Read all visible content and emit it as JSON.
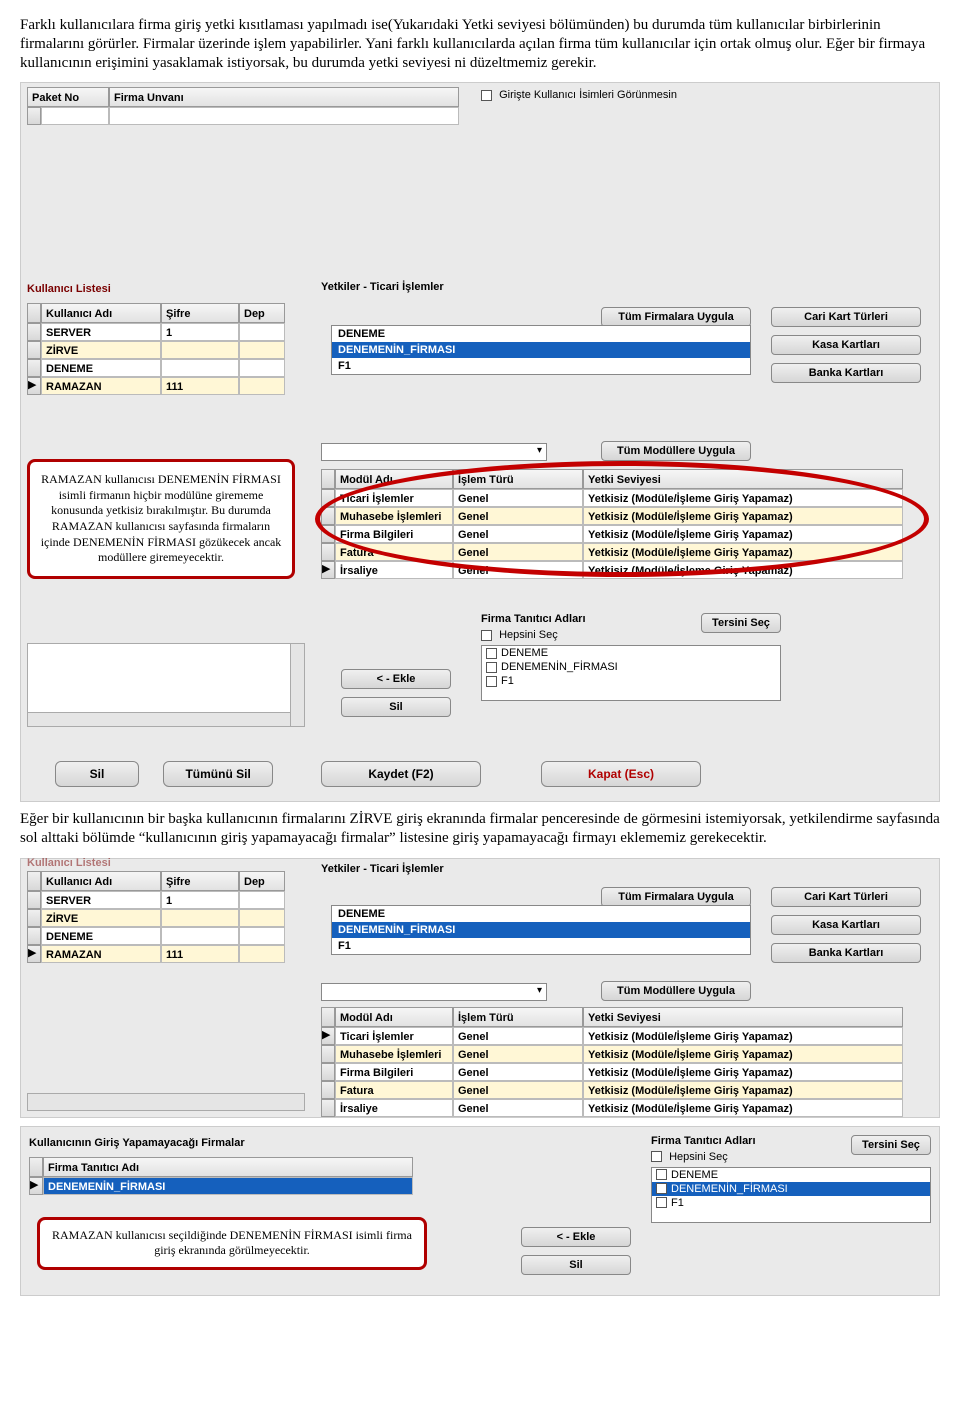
{
  "para1": "Farklı kullanıcılara firma giriş yetki kısıtlaması yapılmadı ise(Yukarıdaki Yetki seviyesi bölümünden) bu durumda tüm kullanıcılar birbirlerinin firmalarını görürler. Firmalar üzerinde işlem yapabilirler. Yani farklı kullanıcılarda açılan firma tüm kullanıcılar için ortak olmuş olur. Eğer bir firmaya kullanıcının erişimini yasaklamak istiyorsak, bu durumda yetki seviyesi ni düzeltmemiz gerekir.",
  "para2": "Eğer bir kullanıcının bir başka kullanıcının firmalarını ZİRVE giriş ekranında firmalar penceresinde de görmesini istemiyorsak, yetkilendirme sayfasında sol alttaki bölümde “kullanıcının giriş yapamayacağı firmalar” listesine giriş yapamayacağı firmayı eklememiz gerekecektir.",
  "callout1": "RAMAZAN kullanıcısı DENEMENİN FİRMASI isimli firmanın hiçbir modülüne girememe konusunda yetkisiz bırakılmıştır. Bu durumda RAMAZAN kullanıcısı sayfasında firmaların içinde DENEMENİN FİRMASI gözükecek ancak modüllere giremeyecektir.",
  "callout2": "RAMAZAN kullanıcısı seçildiğinde DENEMENİN FİRMASI isimli firma giriş ekranında görülmeyecektir.",
  "top": {
    "paketNo": "Paket No",
    "firmaUnvani": "Firma Unvanı",
    "giristeChk": "Girişte Kullanıcı İsimleri Görünmesin"
  },
  "userList": {
    "title": "Kullanıcı Listesi",
    "cols": {
      "ad": "Kullanıcı Adı",
      "sifre": "Şifre",
      "dep": "Dep"
    },
    "rows": [
      {
        "ad": "SERVER",
        "sifre": "1"
      },
      {
        "ad": "ZİRVE",
        "sifre": ""
      },
      {
        "ad": "DENEME",
        "sifre": ""
      },
      {
        "ad": "RAMAZAN",
        "sifre": "111"
      }
    ]
  },
  "yetkiler": {
    "title": "Yetkiler - Ticari İşlemler",
    "tumFirmalara": "Tüm Firmalara Uygula",
    "cariKart": "Cari Kart Türleri",
    "kasa": "Kasa Kartları",
    "banka": "Banka Kartları",
    "firmaListesi": [
      "DENEME",
      "DENEMENİN_FİRMASI",
      "F1"
    ],
    "tumModullere": "Tüm Modüllere Uygula",
    "modulCols": {
      "ad": "Modül Adı",
      "tur": "İşlem Türü",
      "sev": "Yetki Seviyesi"
    },
    "modulRows": [
      {
        "ad": "Ticari İşlemler",
        "tur": "Genel",
        "sev": "Yetkisiz (Modüle/İşleme Giriş Yapamaz)"
      },
      {
        "ad": "Muhasebe İşlemleri",
        "tur": "Genel",
        "sev": "Yetkisiz (Modüle/İşleme Giriş Yapamaz)"
      },
      {
        "ad": "Firma Bilgileri",
        "tur": "Genel",
        "sev": "Yetkisiz (Modüle/İşleme Giriş Yapamaz)"
      },
      {
        "ad": "Fatura",
        "tur": "Genel",
        "sev": "Yetkisiz (Modüle/İşleme Giriş Yapamaz)"
      },
      {
        "ad": "İrsaliye",
        "tur": "Genel",
        "sev": "Yetkisiz (Modüle/İşleme Giriş Yapamaz)"
      }
    ]
  },
  "firmaTanitici": {
    "title": "Firma Tanıtıcı Adları",
    "hepsiniSec": "Hepsini Seç",
    "tersiniSec": "Tersini Seç",
    "items": [
      "DENEME",
      "DENEMENİN_FİRMASI",
      "F1"
    ]
  },
  "girisYapamaz": {
    "title": "Kullanıcının Giriş Yapamayacağı Firmalar",
    "col": "Firma Tanıtıcı Adı",
    "row": "DENEMENİN_FİRMASI"
  },
  "buttons": {
    "ekle": "< - Ekle",
    "sil": "Sil",
    "tumunuSil": "Tümünü Sil",
    "kaydet": "Kaydet (F2)",
    "kapat": "Kapat (Esc)"
  }
}
